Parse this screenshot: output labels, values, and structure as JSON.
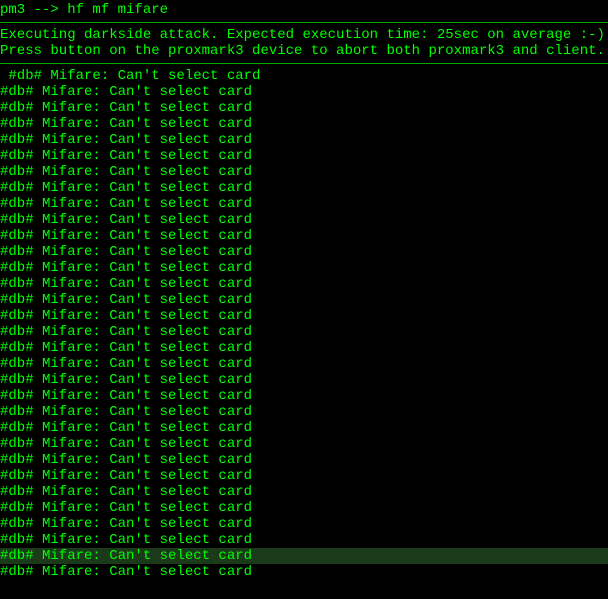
{
  "prompt": "pm3 --> ",
  "command": "hf mf mifare",
  "messages": {
    "line1": "Executing darkside attack. Expected execution time: 25sec on average :-)",
    "line2": "Press button on the proxmark3 device to abort both proxmark3 and client."
  },
  "firstError": " #db# Mifare: Can't select card",
  "errorLine": "#db# Mifare: Can't select card",
  "errorCount": 32
}
